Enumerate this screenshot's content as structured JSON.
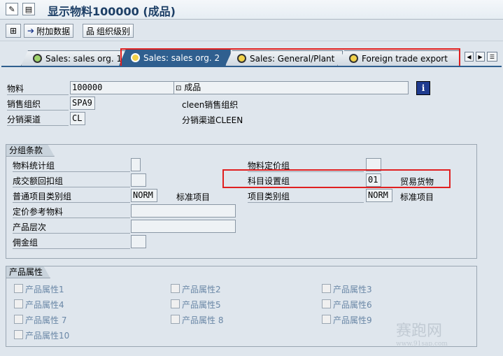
{
  "window": {
    "title": "显示物料100000 (成品)"
  },
  "toolbar": {
    "btn_additional": "附加数据",
    "btn_org_levels": "组织级别"
  },
  "tabs": [
    {
      "label": "Sales: sales org. 1",
      "active": false
    },
    {
      "label": "Sales: sales org. 2",
      "active": true
    },
    {
      "label": "Sales: General/Plant",
      "active": false
    },
    {
      "label": "Foreign trade export",
      "active": false
    }
  ],
  "header": {
    "material_label": "物料",
    "material_value": "100000",
    "material_desc": "成品",
    "sales_org_label": "销售组织",
    "sales_org_value": "SPA9",
    "sales_org_desc": "cleen销售组织",
    "dist_channel_label": "分销渠道",
    "dist_channel_value": "CL",
    "dist_channel_desc": "分销渠道CLEEN"
  },
  "grouping": {
    "title": "分组条款",
    "mat_stat_group_label": "物料统计组",
    "mat_stat_group_value": "",
    "mat_price_group_label": "物料定价组",
    "mat_price_group_value": "",
    "volume_rebate_label": "成交额回扣组",
    "volume_rebate_value": "",
    "acct_assign_label": "科目设置组",
    "acct_assign_value": "01",
    "acct_assign_desc": "贸易货物",
    "gen_item_cat_label": "普通项目类别组",
    "gen_item_cat_value": "NORM",
    "gen_item_cat_desc": "标准项目",
    "item_cat_label": "项目类别组",
    "item_cat_value": "NORM",
    "item_cat_desc": "标准项目",
    "pricing_ref_label": "定价参考物料",
    "pricing_ref_value": "",
    "prod_hier_label": "产品层次",
    "prod_hier_value": "",
    "commission_label": "佣金组",
    "commission_value": ""
  },
  "attributes": {
    "title": "产品属性",
    "items": [
      "产品属性1",
      "产品属性2",
      "产品属性3",
      "产品属性4",
      "产品属性5",
      "产品属性6",
      "产品属性 7",
      "产品属性 8",
      "产品属性9",
      "产品属性10"
    ]
  },
  "watermark": {
    "text": "赛跑网",
    "url": "www.91sap.com"
  },
  "colors": {
    "title": "#1d3f66",
    "tab_active": "#2f5f8f",
    "highlight": "#e02020"
  }
}
